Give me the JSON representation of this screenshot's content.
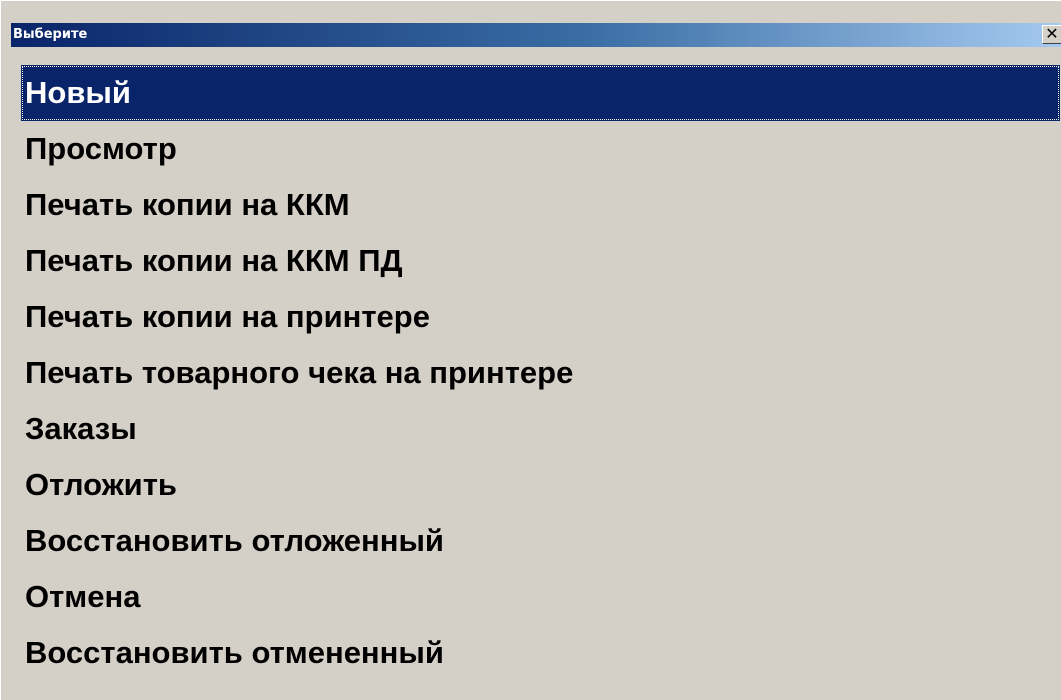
{
  "window": {
    "title": "Выберите",
    "close_label": "✕"
  },
  "menu": {
    "selected_index": 0,
    "items": [
      {
        "label": "Новый"
      },
      {
        "label": "Просмотр"
      },
      {
        "label": "Печать копии на ККМ"
      },
      {
        "label": "Печать копии на ККМ ПД"
      },
      {
        "label": "Печать копии на принтере"
      },
      {
        "label": "Печать товарного чека на принтере"
      },
      {
        "label": "Заказы"
      },
      {
        "label": "Отложить"
      },
      {
        "label": "Восстановить отложенный"
      },
      {
        "label": "Отмена"
      },
      {
        "label": "Восстановить отмененный"
      }
    ]
  },
  "colors": {
    "selection_bg": "#0a246a",
    "window_bg": "#d4d0c8",
    "title_gradient_start": "#0a246a",
    "title_gradient_end": "#a6caf0"
  }
}
